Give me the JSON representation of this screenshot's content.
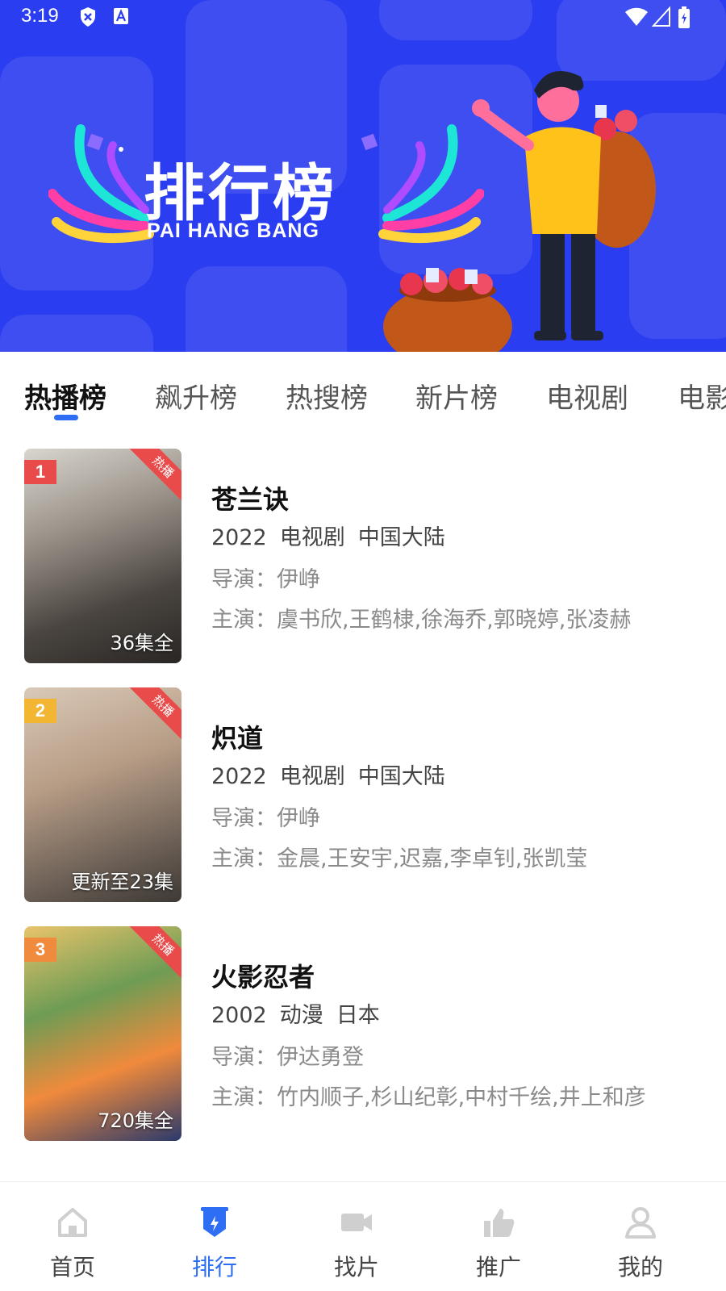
{
  "status_bar": {
    "time": "3:19"
  },
  "banner": {
    "title": "排行榜",
    "subtitle": "PAI HANG BANG"
  },
  "tabs": [
    {
      "label": "热播榜",
      "active": true
    },
    {
      "label": "飙升榜",
      "active": false
    },
    {
      "label": "热搜榜",
      "active": false
    },
    {
      "label": "新片榜",
      "active": false
    },
    {
      "label": "电视剧",
      "active": false
    },
    {
      "label": "电影",
      "active": false
    }
  ],
  "list": [
    {
      "rank": "1",
      "badge": "热播",
      "episodes": "36集全",
      "title": "苍兰诀",
      "year": "2022",
      "type": "电视剧",
      "region": "中国大陆",
      "director": "导演：伊峥",
      "cast": "主演：虞书欣,王鹤棣,徐海乔,郭晓婷,张凌赫",
      "rank_color": "#e94b4b"
    },
    {
      "rank": "2",
      "badge": "热播",
      "episodes": "更新至23集",
      "title": "炽道",
      "year": "2022",
      "type": "电视剧",
      "region": "中国大陆",
      "director": "导演：伊峥",
      "cast": "主演：金晨,王安宇,迟嘉,李卓钊,张凯莹",
      "rank_color": "#f2b632"
    },
    {
      "rank": "3",
      "badge": "热播",
      "episodes": "720集全",
      "title": "火影忍者",
      "year": "2002",
      "type": "动漫",
      "region": "日本",
      "director": "导演：伊达勇登",
      "cast": "主演：竹内顺子,杉山纪彰,中村千绘,井上和彦",
      "rank_color": "#f08a3c"
    }
  ],
  "bottom_nav": [
    {
      "label": "首页",
      "icon": "home-icon",
      "active": false
    },
    {
      "label": "排行",
      "icon": "ranking-icon",
      "active": true
    },
    {
      "label": "找片",
      "icon": "video-camera-icon",
      "active": false
    },
    {
      "label": "推广",
      "icon": "thumbs-up-icon",
      "active": false
    },
    {
      "label": "我的",
      "icon": "user-icon",
      "active": false
    }
  ],
  "colors": {
    "accent": "#2d6ef5",
    "banner": "#2b3df0",
    "hot": "#e94b4b"
  }
}
